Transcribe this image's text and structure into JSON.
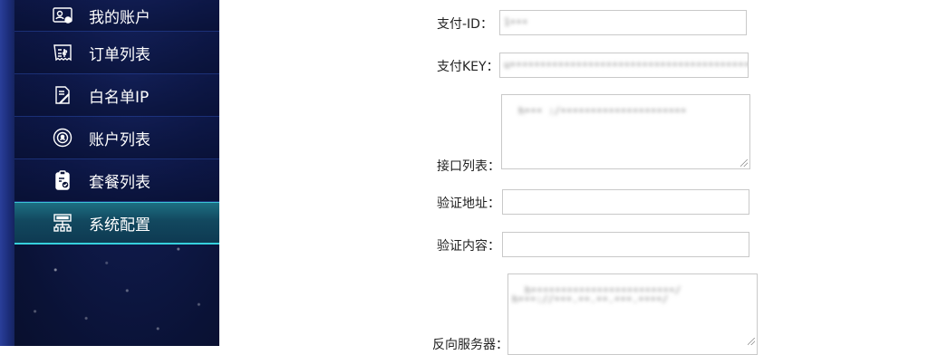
{
  "sidebar": {
    "items": [
      {
        "label": "我的账户",
        "icon": "account-card-icon",
        "active": false
      },
      {
        "label": "订单列表",
        "icon": "receipt-icon",
        "active": false
      },
      {
        "label": "白名单IP",
        "icon": "whitelist-doc-icon",
        "active": false
      },
      {
        "label": "账户列表",
        "icon": "user-circle-icon",
        "active": false
      },
      {
        "label": "套餐列表",
        "icon": "clipboard-check-icon",
        "active": false
      },
      {
        "label": "系统配置",
        "icon": "network-config-icon",
        "active": true
      }
    ]
  },
  "form": {
    "pay_id": {
      "label": "支付-ID：",
      "value": "1•••"
    },
    "pay_key": {
      "label": "支付KEY：",
      "value": "u••••••••••••••••••••••••••••••••••••••••j"
    },
    "api_list": {
      "label": "接口列表：",
      "value": "h••• :/•••••••••••••••••••••"
    },
    "verify_addr": {
      "label": "验证地址：",
      "value": ""
    },
    "verify_content": {
      "label": "验证内容：",
      "value": ""
    },
    "reverse_servers": {
      "label": "反向服务器：",
      "value": "h••••••••••••••••••••••••/\nh•••://•••.••.••.•••.••••/"
    }
  },
  "colors": {
    "sidebar_bg": "#0a1236",
    "active_accent": "#36d0dd"
  }
}
